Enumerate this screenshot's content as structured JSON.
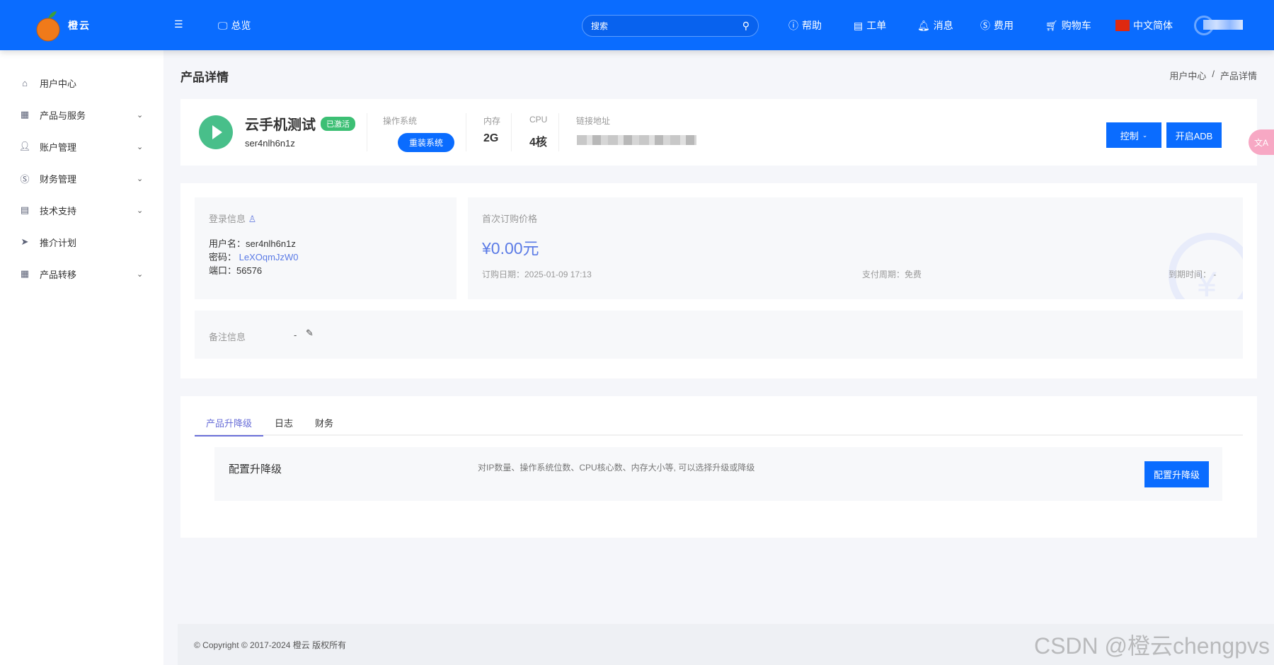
{
  "header": {
    "brand": "橙云",
    "overview": "总览",
    "search_placeholder": "搜索",
    "nav": [
      {
        "label": "帮助",
        "icon": "help-icon"
      },
      {
        "label": "工单",
        "icon": "ticket-icon"
      },
      {
        "label": "消息",
        "icon": "bell-icon"
      },
      {
        "label": "费用",
        "icon": "dollar-icon"
      },
      {
        "label": "购物车",
        "icon": "cart-icon"
      }
    ],
    "language": "中文简体",
    "accent": "#0a6cff"
  },
  "sidebar": {
    "items": [
      {
        "label": "用户中心",
        "icon": "home-icon"
      },
      {
        "label": "产品与服务",
        "icon": "grid-icon",
        "expandable": true
      },
      {
        "label": "账户管理",
        "icon": "user-icon",
        "expandable": true
      },
      {
        "label": "财务管理",
        "icon": "dollar-icon",
        "expandable": true
      },
      {
        "label": "技术支持",
        "icon": "document-icon",
        "expandable": true
      },
      {
        "label": "推介计划",
        "icon": "send-icon"
      },
      {
        "label": "产品转移",
        "icon": "grid-icon",
        "expandable": true
      }
    ]
  },
  "page": {
    "title": "产品详情",
    "breadcrumb": [
      "用户中心",
      "/",
      "产品详情"
    ]
  },
  "product": {
    "name": "云手机测试",
    "status": "已激活",
    "id": "ser4nlh6n1z",
    "os_label": "操作系统",
    "reinstall": "重装系统",
    "memory_label": "内存",
    "memory": "2G",
    "cpu_label": "CPU",
    "cpu": "4核",
    "link_label": "链接地址",
    "control": "控制",
    "adb": "开启ADB"
  },
  "login": {
    "title": "登录信息",
    "username_label": "用户名：",
    "username": "ser4nlh6n1z",
    "password_label": "密码：",
    "password": "LeXOqmJzW0",
    "port_label": "端口：",
    "port": "56576"
  },
  "price": {
    "title": "首次订购价格",
    "amount": "¥0.00元",
    "order_date": "订购日期：2025-01-09 17:13",
    "cycle": "支付周期：免费",
    "expire": "到期时间： -"
  },
  "remark": {
    "label": "备注信息",
    "value": "-"
  },
  "tabs": [
    {
      "label": "产品升降级",
      "active": true
    },
    {
      "label": "日志"
    },
    {
      "label": "财务"
    }
  ],
  "upgrade": {
    "title": "配置升降级",
    "desc": "对IP数量、操作系统位数、CPU核心数、内存大小等, 可以选择升级或降级",
    "button": "配置升降级"
  },
  "footer": {
    "copyright": "© Copyright © 2017-2024 橙云 版权所有"
  },
  "watermark": "CSDN @橙云chengpvs"
}
